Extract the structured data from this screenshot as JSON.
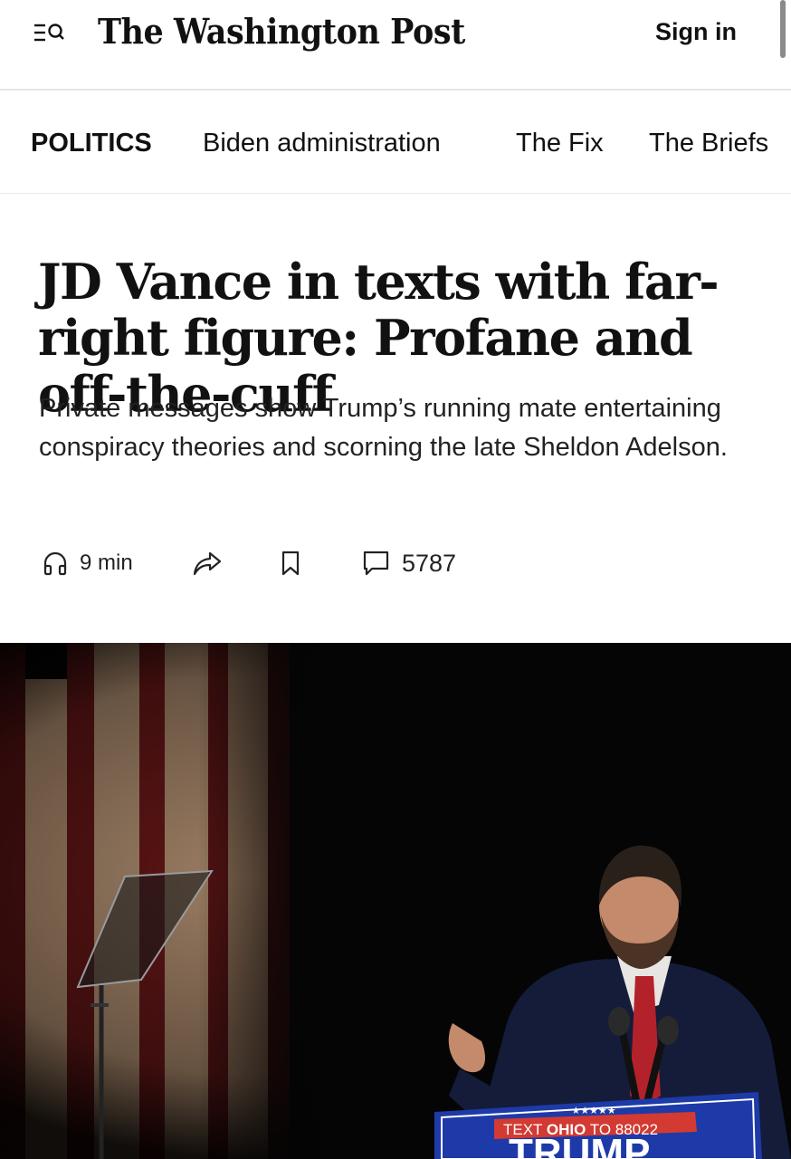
{
  "header": {
    "logo": "The Washington Post",
    "sign_in": "Sign in"
  },
  "section_nav": {
    "title": "POLITICS",
    "items": [
      "Biden administration",
      "The Fix",
      "The Briefs"
    ]
  },
  "article": {
    "headline": "JD Vance in texts with far-right figure: Profane and off-the-cuff",
    "subheadline": "Private messages show Trump’s running mate entertaining conspiracy theories and scorning the late Sheldon Adelson.",
    "actions": {
      "listen_duration": "9 min",
      "comments_count": "5787"
    }
  },
  "lead_image": {
    "sign_stars": "★★★★★",
    "sign_text_pre": "TEXT ",
    "sign_text_bold": "OHIO",
    "sign_text_post": " TO 88022",
    "sign_big": "TRUMP"
  },
  "icons": [
    "search-menu-icon",
    "headphones-icon",
    "share-icon",
    "bookmark-icon",
    "comment-icon"
  ],
  "colors": {
    "text": "#111111",
    "divider": "#e6e6e6",
    "sign_blue": "#1d3aa8",
    "sign_red": "#d23a32"
  }
}
